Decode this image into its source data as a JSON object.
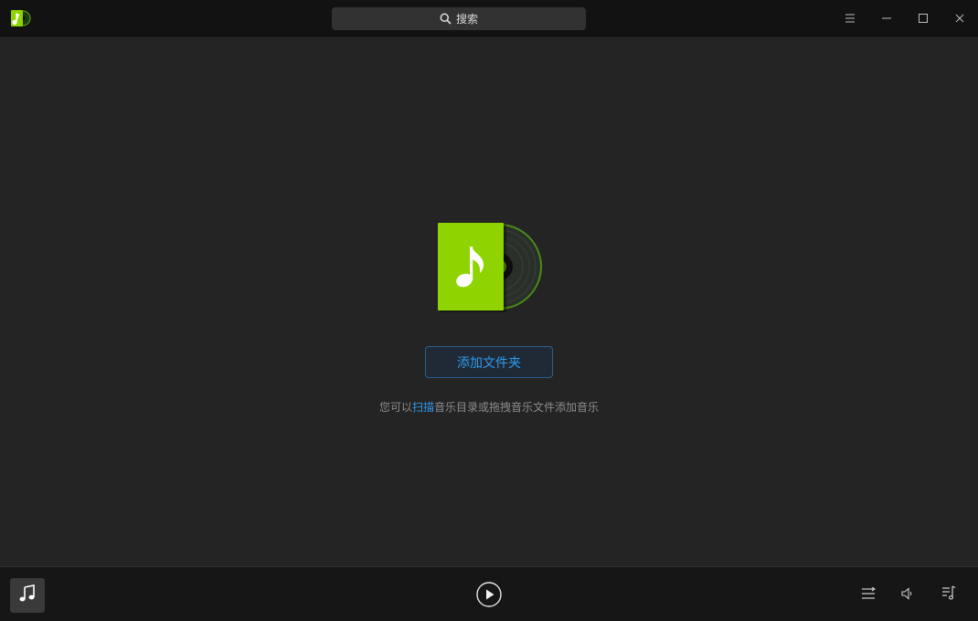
{
  "titlebar": {
    "search_label": "搜索",
    "icons": [
      "app-logo-icon",
      "search-icon",
      "menu-icon",
      "minimize-icon",
      "maximize-icon",
      "close-icon"
    ]
  },
  "empty_state": {
    "add_folder_label": "添加文件夹",
    "hint_prefix": "您可以",
    "hint_link": "扫描",
    "hint_suffix": "音乐目录或拖拽音乐文件添加音乐",
    "art_icon": "music-album-icon"
  },
  "player": {
    "icons": [
      "music-note-icon",
      "play-icon",
      "play-mode-icon",
      "volume-icon",
      "playlist-icon"
    ]
  },
  "colors": {
    "accent": "#2f9bf0",
    "brand_green": "#8fd400",
    "titlebar_bg": "#121212",
    "main_bg": "#242424",
    "player_bg": "#161616"
  }
}
